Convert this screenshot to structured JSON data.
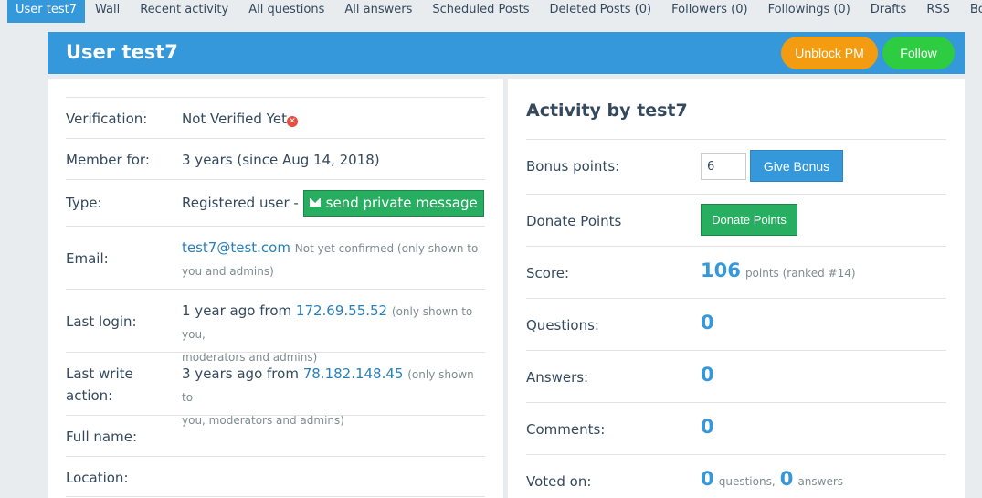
{
  "tabs": [
    {
      "label": "User test7",
      "active": true
    },
    {
      "label": "Wall"
    },
    {
      "label": "Recent activity"
    },
    {
      "label": "All questions"
    },
    {
      "label": "All answers"
    },
    {
      "label": "Scheduled Posts"
    },
    {
      "label": "Deleted Posts (0)"
    },
    {
      "label": "Followers (0)"
    },
    {
      "label": "Followings (0)"
    },
    {
      "label": "Drafts"
    },
    {
      "label": "RSS"
    },
    {
      "label": "Bonus Records"
    }
  ],
  "header": {
    "title": "User test7",
    "unblock_label": "Unblock PM",
    "follow_label": "Follow"
  },
  "profile": {
    "verification": {
      "label": "Verification:",
      "value": "Not Verified Yet",
      "icon": "error-x-icon"
    },
    "member_for": {
      "label": "Member for:",
      "value": "3 years (since Aug 14, 2018)"
    },
    "type": {
      "label": "Type:",
      "value": "Registered user -",
      "pm_button": "send private message"
    },
    "email": {
      "label": "Email:",
      "address": "test7@test.com",
      "note_line1": "Not yet confirmed (only shown to",
      "note_line2": "you and admins)"
    },
    "last_login": {
      "label": "Last login:",
      "prefix": "1 year ago from",
      "ip": "172.69.55.52",
      "note_line1": "(only shown to you,",
      "note_line2": "moderators and admins)"
    },
    "last_write": {
      "label_line1": "Last write",
      "label_line2": "action:",
      "prefix": "3 years ago from",
      "ip": "78.182.148.45",
      "note_line1": "(only shown to",
      "note_line2": "you, moderators and admins)"
    },
    "full_name": {
      "label": "Full name:"
    },
    "location": {
      "label": "Location:"
    }
  },
  "activity": {
    "title": "Activity by test7",
    "bonus": {
      "label": "Bonus points:",
      "input_value": "6",
      "button": "Give Bonus"
    },
    "donate": {
      "label": "Donate Points",
      "button": "Donate Points"
    },
    "score": {
      "label": "Score:",
      "value": "106",
      "suffix": "points (ranked #14)"
    },
    "questions": {
      "label": "Questions:",
      "value": "0"
    },
    "answers": {
      "label": "Answers:",
      "value": "0"
    },
    "comments": {
      "label": "Comments:",
      "value": "0"
    },
    "voted_on": {
      "label": "Voted on:",
      "questions_value": "0",
      "questions_suffix": "questions,",
      "answers_value": "0",
      "answers_suffix": "answers"
    }
  },
  "colors": {
    "accent": "#3498db",
    "orange": "#f39c12",
    "green": "#2ecc40",
    "success": "#27ae60",
    "error": "#e74c3c"
  }
}
